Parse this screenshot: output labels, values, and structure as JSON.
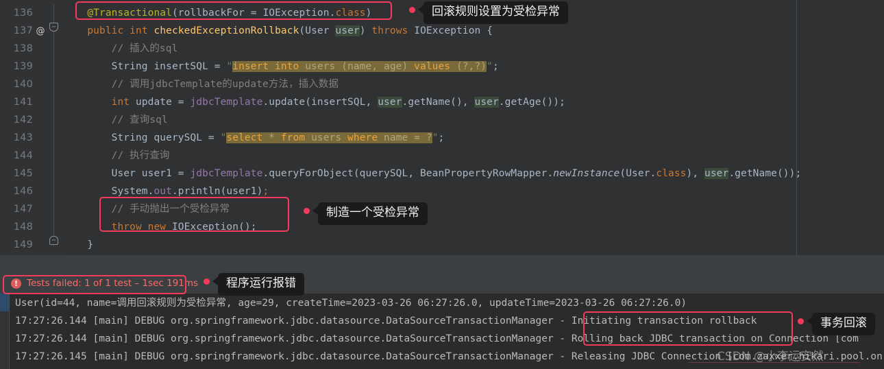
{
  "editor": {
    "lines": [
      {
        "num": "136",
        "marker": "",
        "code": "    <span class=\"ann\">@Transactional</span><span class=\"plain\">(</span><span class=\"plain\">rollbackFor</span> <span class=\"plain\">=</span> <span class=\"plain\">IOException</span><span class=\"plain\">.</span><span class=\"kw\">class</span><span class=\"plain\">)</span>",
        "text": "@Transactional(rollbackFor = IOException.class)"
      },
      {
        "num": "137",
        "marker": "@",
        "code": "    <span class=\"kw\">public</span> <span class=\"kw\">int</span> <span class=\"meth\">checkedExceptionRollback</span><span class=\"plain\">(User </span><span class=\"usrhl\">user</span><span class=\"plain\">) </span><span class=\"kw\">throws</span> <span class=\"plain\">IOException {</span>",
        "text": "public int checkedExceptionRollback(User user) throws IOException {"
      },
      {
        "num": "138",
        "marker": "",
        "code": "        <span class=\"cmt\">// 插入的sql</span>",
        "text": "// 插入的sql"
      },
      {
        "num": "139",
        "marker": "",
        "code": "        <span class=\"plain\">String insertSQL = </span><span class=\"str\">\"</span><span class=\"sqlkw\">insert into </span><span class=\"sqlid\">users (name, age) </span><span class=\"sqlkw\">values </span><span class=\"sqlid\">(?,?)</span><span class=\"str\">\"</span><span class=\"plain\">;</span>",
        "text": "String insertSQL = \"insert into users (name, age) values (?,?)\";"
      },
      {
        "num": "140",
        "marker": "",
        "code": "        <span class=\"cmt\">// 调用jdbcTemplate的update方法，插入数据</span>",
        "text": "// 调用jdbcTemplate的update方法，插入数据"
      },
      {
        "num": "141",
        "marker": "",
        "code": "        <span class=\"kw\">int</span> <span class=\"plain\">update = </span><span class=\"field\">jdbcTemplate</span><span class=\"plain\">.update(insertSQL, </span><span class=\"usrhl\">user</span><span class=\"plain\">.getName(), </span><span class=\"usrhl\">user</span><span class=\"plain\">.getAge());</span>",
        "text": "int update = jdbcTemplate.update(insertSQL, user.getName(), user.getAge());"
      },
      {
        "num": "142",
        "marker": "",
        "code": "        <span class=\"cmt\">// 查询sql</span>",
        "text": "// 查询sql"
      },
      {
        "num": "143",
        "marker": "",
        "code": "        <span class=\"plain\">String querySQL = </span><span class=\"str\">\"</span><span class=\"sqlkw\">select </span><span class=\"sqlid\">* </span><span class=\"sqlkw\">from </span><span class=\"sqlid\">users </span><span class=\"sqlkw\">where </span><span class=\"sqlid\">name = ?</span><span class=\"str\">\"</span><span class=\"plain\">;</span>",
        "text": "String querySQL = \"select * from users where name = ?\";"
      },
      {
        "num": "144",
        "marker": "",
        "code": "        <span class=\"cmt\">// 执行查询</span>",
        "text": "// 执行查询"
      },
      {
        "num": "145",
        "marker": "",
        "code": "        <span class=\"plain\">User user1 = </span><span class=\"field\">jdbcTemplate</span><span class=\"plain\">.queryForObject(querySQL, BeanPropertyRowMapper.</span><span class=\"ital\">newInstance</span><span class=\"plain\">(User.</span><span class=\"kw\">class</span><span class=\"plain\">), </span><span class=\"usrhl\">user</span><span class=\"plain\">.getName());</span>",
        "text": "User user1 = jdbcTemplate.queryForObject(querySQL, BeanPropertyRowMapper.newInstance(User.class), user.getName());"
      },
      {
        "num": "146",
        "marker": "",
        "code": "        <span class=\"plain\">System.</span><span class=\"field\">out</span><span class=\"plain\">.println(user1)</span><span class=\"kw\">;</span>",
        "text": "System.out.println(user1);"
      },
      {
        "num": "147",
        "marker": "",
        "code": "        <span class=\"cmt\">// 手动抛出一个受检异常</span>",
        "text": "// 手动抛出一个受检异常"
      },
      {
        "num": "148",
        "marker": "",
        "code": "        <span class=\"kw\">throw new</span> <span class=\"plain\">IOException();</span>",
        "text": "throw new IOException();"
      },
      {
        "num": "149",
        "marker": "",
        "code": "    <span class=\"plain\">}</span>",
        "text": "}"
      }
    ]
  },
  "console": {
    "test_status": {
      "icon": "error-icon",
      "icon_glyph": "!",
      "text": "Tests failed: 1 of 1 test – 1sec 191ms"
    },
    "lines": [
      "User(id=44, name=调用回滚规则为受检异常, age=29, createTime=2023-03-26 06:27:26.0, updateTime=2023-03-26 06:27:26.0)",
      "17:27:26.144 [main] DEBUG org.springframework.jdbc.datasource.DataSourceTransactionManager - Initiating transaction rollback",
      "17:27:26.144 [main] DEBUG org.springframework.jdbc.datasource.DataSourceTransactionManager - Rolling back JDBC transaction on Connection [com",
      "17:27:26.145 [main] DEBUG org.springframework.jdbc.datasource.DataSourceTransactionManager - Releasing JDBC Connection [com.zaxxer.hikari.pool.on"
    ]
  },
  "annotations": {
    "callout_rollback_rule": "回滚规则设置为受检异常",
    "callout_make_exception": "制造一个受检异常",
    "callout_run_error": "程序运行报错",
    "callout_tx_rollback": "事务回滚"
  },
  "watermark": "CSDN @小李运安然",
  "colors": {
    "accent_red": "#f43b5c",
    "editor_bg": "#2f3133",
    "console_bg": "#2b2b2b",
    "panel_bg": "#3c3f41"
  }
}
